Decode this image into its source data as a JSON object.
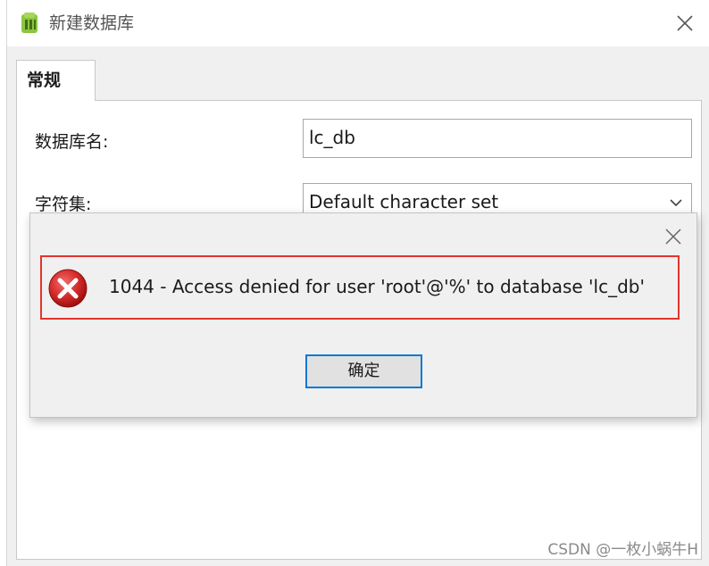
{
  "window": {
    "title": "新建数据库",
    "app_icon": "navicat-db-icon",
    "close_icon": "close-icon"
  },
  "tabs": [
    {
      "label": "常规",
      "selected": true
    }
  ],
  "form": {
    "db_name_label": "数据库名:",
    "db_name_value": "lc_db",
    "charset_label": "字符集:",
    "charset_value": "Default character set"
  },
  "error_dialog": {
    "message": "1044 - Access denied for user 'root'@'%' to database 'lc_db'",
    "icon": "error-icon",
    "ok_label": "确定"
  },
  "watermark": "CSDN @一枚小蜗牛H",
  "colors": {
    "error_border": "#e3342f",
    "button_focus": "#0a78d7",
    "error_icon": "#c8102e"
  }
}
